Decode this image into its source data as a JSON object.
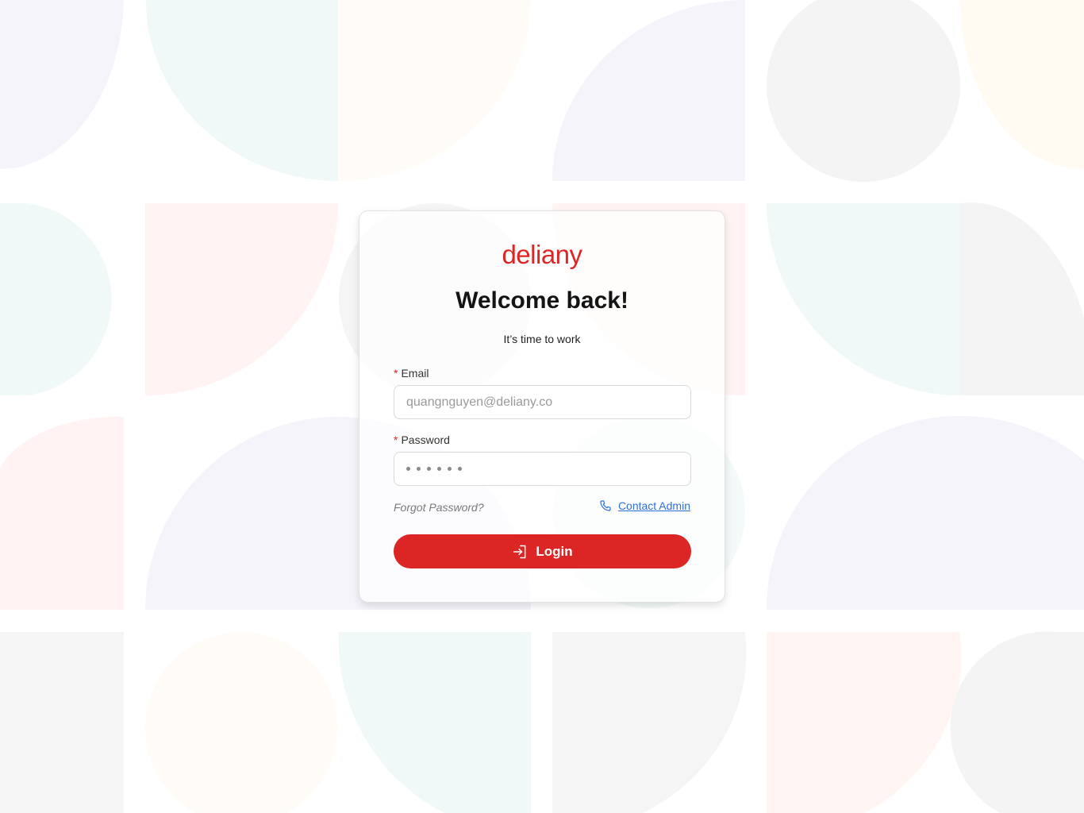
{
  "brand": {
    "logo_text": "deliany",
    "accent_color": "#dc2626"
  },
  "login_card": {
    "title": "Welcome back!",
    "subtitle": "It’s time to work",
    "email": {
      "label": "Email",
      "required_marker": "*",
      "placeholder": "quangnguyen@deliany.co"
    },
    "password": {
      "label": "Password",
      "required_marker": "*",
      "masked_length": 6
    },
    "forgot_password_label": "Forgot Password?",
    "contact_admin_label": "Contact Admin",
    "contact_icon": "phone-icon",
    "login_label": "Login",
    "login_icon": "login-icon",
    "link_color": "#2f6fd6"
  }
}
